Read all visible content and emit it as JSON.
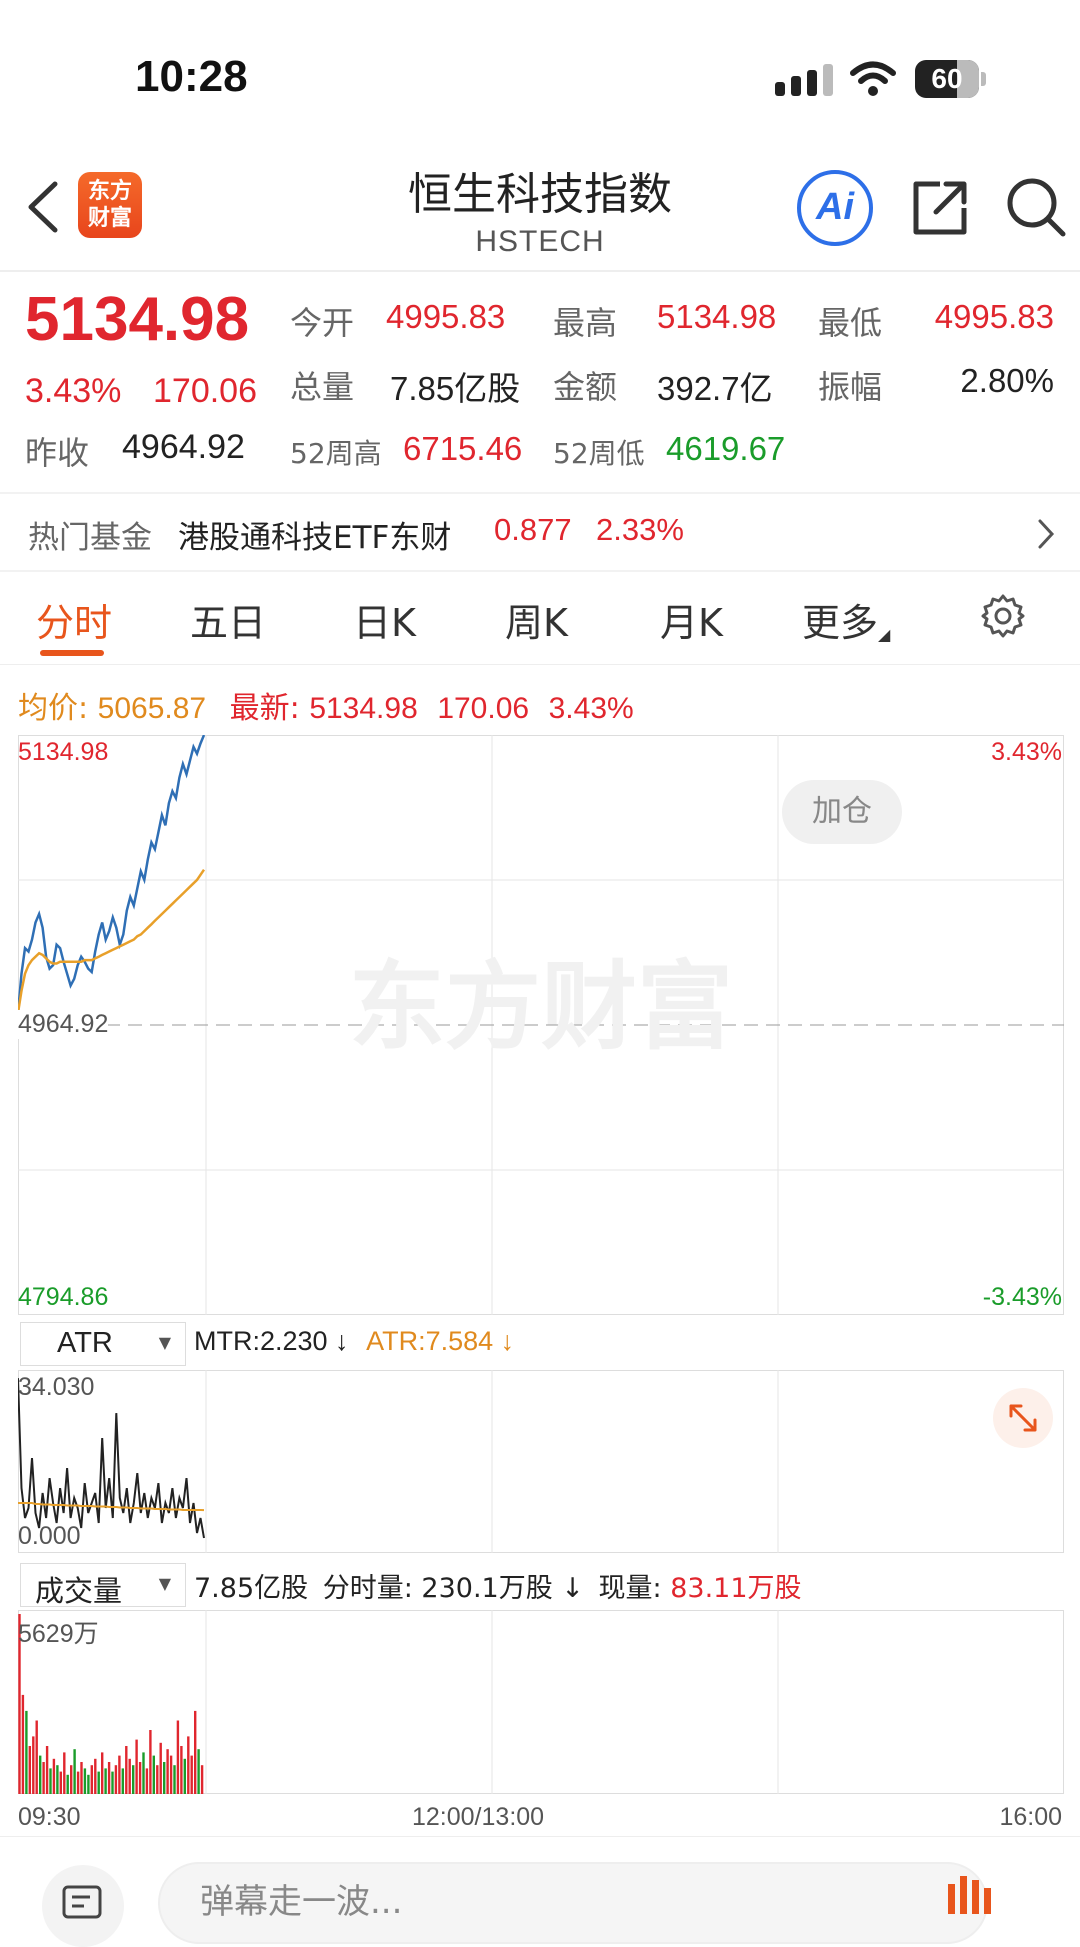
{
  "status": {
    "time": "10:28",
    "battery": "60"
  },
  "header": {
    "title": "恒生科技指数",
    "subtitle": "HSTECH",
    "logo_text": [
      "东方",
      "财富"
    ],
    "ai_label": "Ai"
  },
  "quote": {
    "price": "5134.98",
    "change_pct": "3.43%",
    "change": "170.06",
    "open_label": "今开",
    "open": "4995.83",
    "high_label": "最高",
    "high": "5134.98",
    "low_label": "最低",
    "low": "4995.83",
    "volume_label": "总量",
    "volume": "7.85亿股",
    "amount_label": "金额",
    "amount": "392.7亿",
    "amplitude_label": "振幅",
    "amplitude": "2.80%",
    "prev_close_label": "昨收",
    "prev_close": "4964.92",
    "w52_high_label": "52周高",
    "w52_high": "6715.46",
    "w52_low_label": "52周低",
    "w52_low": "4619.67"
  },
  "fund": {
    "label": "热门基金",
    "name": "港股通科技ETF东财",
    "price": "0.877",
    "pct": "2.33%"
  },
  "tabs": [
    "分时",
    "五日",
    "日K",
    "周K",
    "月K",
    "更多"
  ],
  "chart": {
    "avg_label": "均价:",
    "avg": "5065.87",
    "latest_label": "最新:",
    "latest": "5134.98",
    "latest_change": "170.06",
    "latest_pct": "3.43%",
    "y_top": "5134.98",
    "y_mid": "4964.92",
    "y_bottom": "4794.86",
    "pct_top": "3.43%",
    "pct_bottom": "-3.43%",
    "add_position": "加仓",
    "watermark": "东方财富"
  },
  "atr": {
    "selector": "ATR",
    "mtr": "MTR:2.230 ↓",
    "atr": "ATR:7.584 ↓",
    "y_top": "34.030",
    "y_bottom": "0.000"
  },
  "volume": {
    "selector": "成交量",
    "total": "7.85亿股",
    "minute_label": "分时量:",
    "minute": "230.1万股 ↓",
    "current_label": "现量:",
    "current": "83.11万股",
    "y_top": "5629万"
  },
  "time_axis": {
    "start": "09:30",
    "mid": "12:00/13:00",
    "end": "16:00"
  },
  "bottom": {
    "comment_placeholder": "弹幕走一波..."
  },
  "colors": {
    "up": "#e0262e",
    "down": "#1a9c2a",
    "accent": "#e8551c",
    "avg_line": "#e8a02a",
    "price_line": "#2f6fb5"
  },
  "chart_data": {
    "type": "line",
    "x_range": [
      "09:30",
      "16:00"
    ],
    "ylim": [
      4794.86,
      5134.98
    ],
    "series": [
      {
        "values": [
          4972,
          4995,
          5010,
          5008,
          5015,
          5025,
          5030,
          5022,
          5005,
          4998,
          5000,
          5012,
          5010,
          5002,
          4995,
          4988,
          4992,
          5000,
          5005,
          5002,
          4998,
          4996,
          5008,
          5018,
          5025,
          5015,
          5020,
          5028,
          5022,
          5012,
          5018,
          5032,
          5040,
          5035,
          5045,
          5055,
          5050,
          5062,
          5072,
          5068,
          5078,
          5088,
          5082,
          5095,
          5102,
          5098,
          5110,
          5118,
          5112,
          5120,
          5128,
          5124,
          5130,
          5134.98
        ]
      },
      {
        "values": [
          4972,
          4985,
          4995,
          5000,
          5003,
          5005,
          5007,
          5006,
          5004,
          5002,
          5001,
          5001,
          5002,
          5002,
          5002,
          5002,
          5002,
          5002,
          5002,
          5003,
          5003,
          5003,
          5004,
          5005,
          5006,
          5007,
          5008,
          5009,
          5010,
          5011,
          5012,
          5013,
          5014,
          5015,
          5017,
          5018,
          5020,
          5022,
          5024,
          5026,
          5028,
          5030,
          5032,
          5034,
          5036,
          5038,
          5040,
          5042,
          5044,
          5046,
          5048,
          5050,
          5053,
          5056
        ]
      }
    ]
  },
  "atr_data": {
    "ylim": [
      0,
      34.03
    ],
    "values": [
      34,
      12,
      6,
      8,
      18,
      7,
      4,
      11,
      6,
      14,
      9,
      5,
      12,
      7,
      16,
      6,
      10,
      8,
      4,
      13,
      7,
      9,
      11,
      5,
      22,
      8,
      14,
      6,
      27,
      10,
      7,
      12,
      5,
      9,
      15,
      7,
      11,
      6,
      10,
      8,
      13,
      5,
      9,
      7,
      12,
      6,
      10,
      8,
      14,
      5,
      9,
      3,
      6,
      2
    ],
    "avg": [
      9,
      9,
      9,
      9,
      9,
      8.8,
      8.8,
      8.7,
      8.7,
      8.7,
      8.6,
      8.6,
      8.6,
      8.6,
      8.5,
      8.5,
      8.5,
      8.5,
      8.4,
      8.4,
      8.4,
      8.4,
      8.3,
      8.3,
      8.3,
      8.3,
      8.2,
      8.2,
      8.2,
      8.1,
      8.1,
      8.1,
      8.0,
      8.0,
      8.0,
      7.9,
      7.9,
      7.9,
      7.9,
      7.8,
      7.8,
      7.8,
      7.8,
      7.7,
      7.7,
      7.7,
      7.7,
      7.6,
      7.6,
      7.6,
      7.6,
      7.6,
      7.6,
      7.58
    ]
  },
  "volume_data": {
    "ylim": [
      0,
      5629
    ],
    "values": [
      5629,
      3100,
      2600,
      1500,
      1800,
      2300,
      1200,
      1000,
      1500,
      800,
      1100,
      900,
      700,
      1300,
      600,
      900,
      1400,
      700,
      1000,
      800,
      600,
      900,
      1100,
      700,
      1300,
      800,
      1000,
      700,
      900,
      1200,
      800,
      1500,
      1100,
      900,
      1700,
      1000,
      1300,
      800,
      2000,
      1200,
      900,
      1600,
      1000,
      1400,
      1200,
      900,
      2300,
      1500,
      1100,
      1800,
      1200,
      2600,
      1400,
      900
    ],
    "colors": [
      "r",
      "r",
      "g",
      "r",
      "r",
      "r",
      "g",
      "r",
      "r",
      "g",
      "r",
      "g",
      "r",
      "r",
      "g",
      "r",
      "g",
      "r",
      "r",
      "g",
      "g",
      "r",
      "r",
      "g",
      "r",
      "g",
      "r",
      "g",
      "r",
      "r",
      "g",
      "r",
      "r",
      "g",
      "r",
      "r",
      "g",
      "r",
      "r",
      "g",
      "r",
      "r",
      "g",
      "r",
      "r",
      "g",
      "r",
      "r",
      "g",
      "r",
      "r",
      "r",
      "g",
      "r"
    ]
  }
}
